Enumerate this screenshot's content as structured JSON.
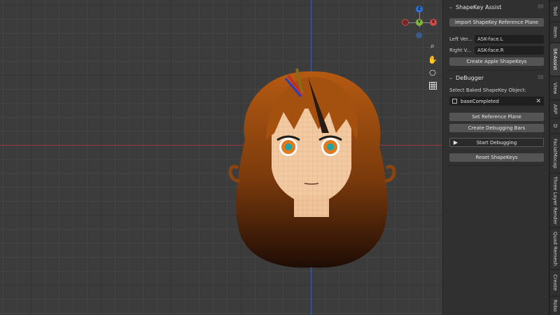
{
  "viewport": {
    "gizmo": {
      "z": "Z",
      "y": "Y",
      "x": "X"
    },
    "nav_icons": [
      "zoom-icon",
      "hand-pan-icon",
      "camera-icon",
      "grid-icon"
    ]
  },
  "panel": {
    "shapekey_assist": {
      "title": "ShapeKey Assist",
      "import_button": "Import ShapeKey Reference Plane",
      "left_label": "Left Ver...",
      "left_value": "ASK-face.L",
      "right_label": "Right V...",
      "right_value": "ASK-face.R",
      "create_button": "Create Apple ShapeKeys"
    },
    "debugger": {
      "title": "DeBugger",
      "select_label": "Select Baked ShapeKey Object:",
      "object_value": "baseCompleted",
      "set_reference_button": "Set Reference Plane",
      "create_bars_button": "Create Debugging Bars",
      "start_button": "Start Debugging",
      "reset_button": "Reset ShapeKeys"
    }
  },
  "tabs": [
    "Tool",
    "Item",
    "SK-Assist",
    "View",
    "ARP",
    "D",
    "FacialMocap",
    "Three Layer Render",
    "Quad Remesh",
    "Create",
    "Robo"
  ],
  "colors": {
    "x_axis": "#9b3a44",
    "y_axis": "#3f5fae",
    "panel_bg": "#303030"
  }
}
